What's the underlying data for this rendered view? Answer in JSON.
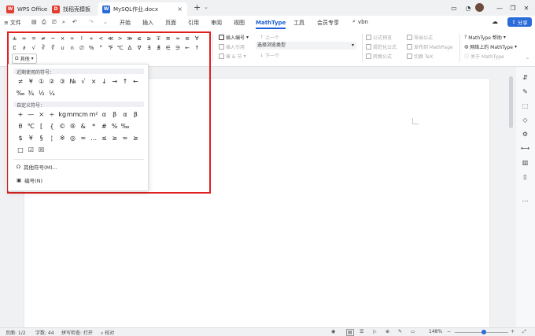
{
  "titlebar": {
    "tabs": [
      {
        "label": "WPS Office",
        "icon": "wps-logo"
      },
      {
        "label": "找稻壳模板",
        "icon": "docer-logo"
      },
      {
        "label": "MySQL作业.docx",
        "icon": "word-doc-icon"
      }
    ],
    "new_tab": "+",
    "window_buttons": [
      "minimize",
      "maximize",
      "close"
    ]
  },
  "menubar": {
    "file": "文件",
    "items": [
      "开始",
      "插入",
      "页面",
      "引用",
      "审阅",
      "视图",
      "MathType",
      "工具",
      "会员专享"
    ],
    "active": "MathType",
    "search": "vbn",
    "share": "分享"
  },
  "ribbon": {
    "symbols_row1": [
      "±",
      "∞",
      "=",
      "≠",
      "~",
      "×",
      "÷",
      "!",
      "∝",
      "<",
      "≪",
      ">",
      "≫",
      "≤",
      "≥",
      "∓",
      "≅",
      "≈",
      "≡",
      "∀"
    ],
    "symbols_row2": [
      "∁",
      "∂",
      "√",
      "∛",
      "∜",
      "∪",
      "∩",
      "∅",
      "%",
      "°",
      "℉",
      "℃",
      "∆",
      "∇",
      "∃",
      "∄",
      "∈",
      "∋",
      "←",
      "↑"
    ],
    "other_label": "其他",
    "insert_number": "插入编号",
    "insert_reference": "插入引用",
    "chapter": "章 & 节",
    "prev": "上一个",
    "select_browse": "选择浏览类型",
    "next": "下一个",
    "formula_preview": "公式预览",
    "standardize_formula": "规范化公式",
    "convert_formula": "转换公式",
    "export_formula": "导出公式",
    "publish_mathpage": "发布到 MathPage",
    "toggle_tex": "切换 TeX",
    "mathtype_help": "MathType 帮助",
    "mathtype_online": "网络上的 MathType",
    "about_mathtype": "关于 MathType"
  },
  "popup": {
    "recent_title": "近期使用的符号：",
    "recent_row1": [
      "≠",
      "¥",
      "①",
      "②",
      "③",
      "№",
      "√",
      "×",
      "↓",
      "→",
      "↑",
      "←"
    ],
    "recent_row2": [
      "‰",
      "¾",
      "½",
      "¼"
    ],
    "custom_title": "自定义符号：",
    "custom_row1": [
      "+",
      "—",
      "×",
      "÷",
      "kg",
      "mm",
      "cm",
      "m²",
      "α",
      "β",
      "α",
      "β"
    ],
    "custom_row2": [
      "θ",
      "℃",
      "[",
      "{",
      "©",
      "®",
      "&",
      "*",
      "#",
      "%",
      "‰"
    ],
    "custom_row3": [
      "$",
      "¥",
      "§",
      "¦",
      "※",
      "◎",
      "≈",
      "…",
      "≤",
      "≥",
      "≈",
      "≥"
    ],
    "custom_row4": [
      "□",
      "☑",
      "☒"
    ],
    "other_symbols": "其他符号(M)...",
    "numbering": "编号(N)"
  },
  "status": {
    "page": "页面: 1/2",
    "words": "字数: 44",
    "spell": "拼写检查: 打开",
    "proof": "校对",
    "zoom": "148%",
    "zoom_fraction": 0.55
  }
}
